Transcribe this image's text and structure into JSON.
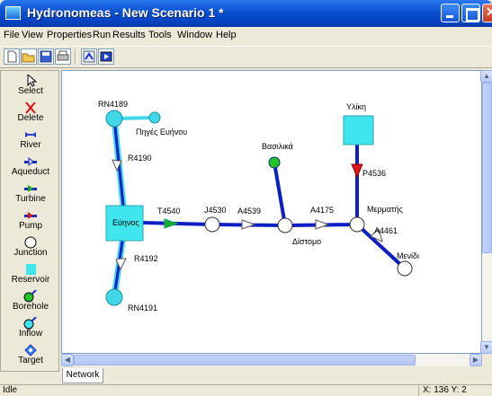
{
  "window": {
    "title": "Hydronomeas - New Scenario 1 *"
  },
  "menu": [
    "File",
    "View",
    "Properties",
    "Run",
    "Results",
    "Tools",
    "Window",
    "Help"
  ],
  "toolbar": [
    "new-icon",
    "open-icon",
    "save-icon",
    "print-icon",
    "network-icon",
    "run-icon"
  ],
  "palette": [
    {
      "label": "Select",
      "icon": "arrow-cursor-icon"
    },
    {
      "label": "Delete",
      "icon": "delete-icon"
    },
    {
      "label": "River",
      "icon": "river-icon"
    },
    {
      "label": "Aqueduct",
      "icon": "aqueduct-icon"
    },
    {
      "label": "Turbine",
      "icon": "turbine-icon"
    },
    {
      "label": "Pump",
      "icon": "pump-icon"
    },
    {
      "label": "Junction",
      "icon": "junction-icon"
    },
    {
      "label": "Reservoir",
      "icon": "reservoir-icon"
    },
    {
      "label": "Borehole",
      "icon": "borehole-icon"
    },
    {
      "label": "Inflow",
      "icon": "inflow-icon"
    },
    {
      "label": "Target",
      "icon": "target-icon"
    }
  ],
  "network": {
    "nodes": {
      "rn4189": "RN4189",
      "piges": "Πηγές Ευήνου",
      "evinos": "Εύηνος",
      "rn4191": "RN4191",
      "j4530": "J4530",
      "vasiliki": "Βασιλικά",
      "distomo": "Δίστομο",
      "merpatis": "Μερματής",
      "mornos": "Υλίκη",
      "menidi": "Μενίδι"
    },
    "links": {
      "r4190": "R4190",
      "r4192": "R4192",
      "t4540": "T4540",
      "a4539": "A4539",
      "a4175": "A4175",
      "p4536": "P4536",
      "a4461": "A4461"
    },
    "colors": {
      "aqueduct": "#0b1fc4",
      "river": "#40d7e8",
      "reservoir": "#3fe6ee",
      "turbine": "#1ea828",
      "pump": "#d81818",
      "borehole": "#22c42a"
    }
  },
  "tabs": [
    "Network"
  ],
  "status": {
    "left": "Idle",
    "right": "X: 136 Y: 2"
  }
}
